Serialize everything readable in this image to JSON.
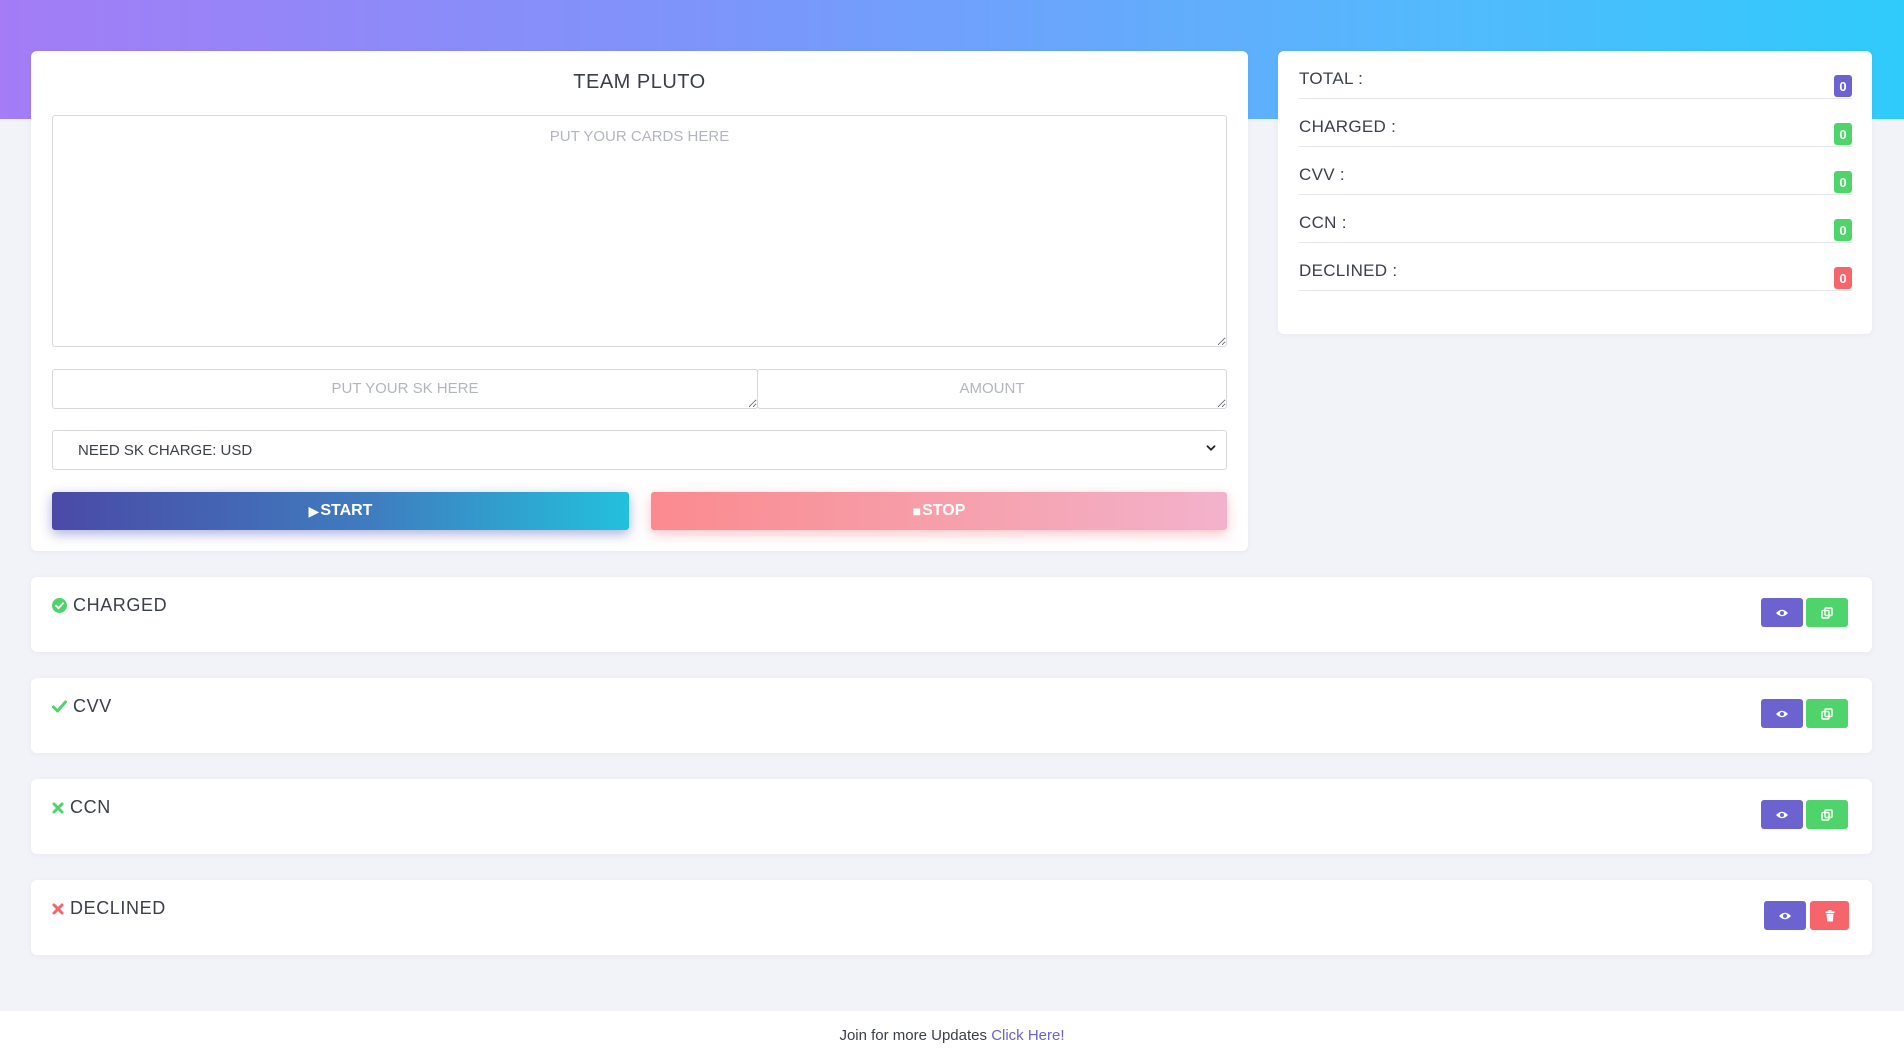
{
  "main": {
    "title": "TEAM PLUTO",
    "cards_placeholder": "PUT YOUR CARDS HERE",
    "sk_placeholder": "PUT YOUR SK HERE",
    "amount_placeholder": "AMOUNT",
    "select_value": "NEED SK CHARGE: USD",
    "start_label": "START",
    "stop_label": "STOP"
  },
  "stats": {
    "total": {
      "label": "TOTAL :",
      "value": "0",
      "color": "#6c63d0"
    },
    "charged": {
      "label": "CHARGED :",
      "value": "0",
      "color": "#4fd36b"
    },
    "cvv": {
      "label": "CVV :",
      "value": "0",
      "color": "#4fd36b"
    },
    "ccn": {
      "label": "CCN :",
      "value": "0",
      "color": "#4fd36b"
    },
    "declined": {
      "label": "DECLINED :",
      "value": "0",
      "color": "#f6646c"
    }
  },
  "results": {
    "charged": {
      "title": "CHARGED",
      "icon": "check-circle-icon"
    },
    "cvv": {
      "title": "CVV",
      "icon": "check-icon"
    },
    "ccn": {
      "title": "CCN",
      "icon": "x-icon"
    },
    "declined": {
      "title": "DECLINED",
      "icon": "x-icon"
    }
  },
  "footer": {
    "text": "Join for more Updates",
    "link": "Click Here!"
  },
  "colors": {
    "purple": "#6c63d0",
    "green": "#4fd36b",
    "red": "#f6646c"
  }
}
